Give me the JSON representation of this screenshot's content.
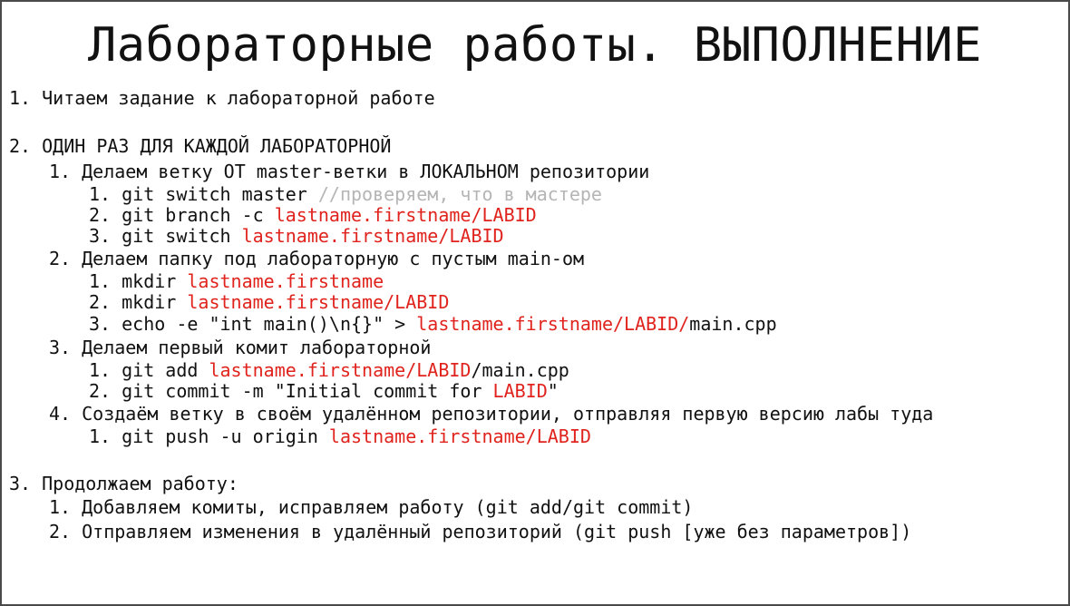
{
  "title": "Лабораторные работы. ВЫПОЛНЕНИЕ",
  "colors": {
    "accent": "#e0231d",
    "comment": "#b5b5b5",
    "text": "#111111"
  },
  "items": [
    {
      "num": "1.",
      "text": "Читаем задание к лабораторной работе"
    },
    {
      "num": "2.",
      "text": "ОДИН РАЗ ДЛЯ КАЖДОЙ ЛАБОРАТОРНОЙ",
      "subitems": [
        {
          "num": "1.",
          "text": "Делаем ветку ОТ master-ветки в ЛОКАЛЬНОМ репозитории",
          "steps": [
            {
              "num": "1.",
              "cmd": "git switch master ",
              "comment": "//проверяем, что в мастере"
            },
            {
              "num": "2.",
              "cmd": "git branch -c ",
              "arg": "lastname.firstname/LABID"
            },
            {
              "num": "3.",
              "cmd": "git switch ",
              "arg": "lastname.firstname/LABID"
            }
          ]
        },
        {
          "num": "2.",
          "text": "Делаем папку под лабораторную с пустым main-ом",
          "steps": [
            {
              "num": "1.",
              "cmd": "mkdir ",
              "arg": "lastname.firstname"
            },
            {
              "num": "2.",
              "cmd": "mkdir ",
              "arg": "lastname.firstname/LABID"
            },
            {
              "num": "3.",
              "cmd": "echo -e \"int main()\\n{}\" > ",
              "arg": "lastname.firstname/LABID/",
              "tail": "main.cpp"
            }
          ]
        },
        {
          "num": "3.",
          "text": "Делаем первый комит лабораторной",
          "steps": [
            {
              "num": "1.",
              "cmd": "git add ",
              "arg": "lastname.firstname/LABID",
              "tail": "/main.cpp"
            },
            {
              "num": "2.",
              "cmd": "git commit -m \"Initial commit for ",
              "arg": "LABID",
              "tail": "\""
            }
          ]
        },
        {
          "num": "4.",
          "text": "Создаём ветку в своём удалённом репозитории, отправляя первую версию лабы туда",
          "steps": [
            {
              "num": "1.",
              "cmd": "git push -u origin ",
              "arg": "lastname.firstname/LABID"
            }
          ]
        }
      ]
    },
    {
      "num": "3.",
      "text": "Продолжаем работу:",
      "subitems": [
        {
          "num": "1.",
          "text": "Добавляем комиты, исправляем работу (git add/git commit)"
        },
        {
          "num": "2.",
          "text": "Отправляем изменения в удалённый репозиторий (git push [уже без параметров])"
        }
      ]
    }
  ]
}
